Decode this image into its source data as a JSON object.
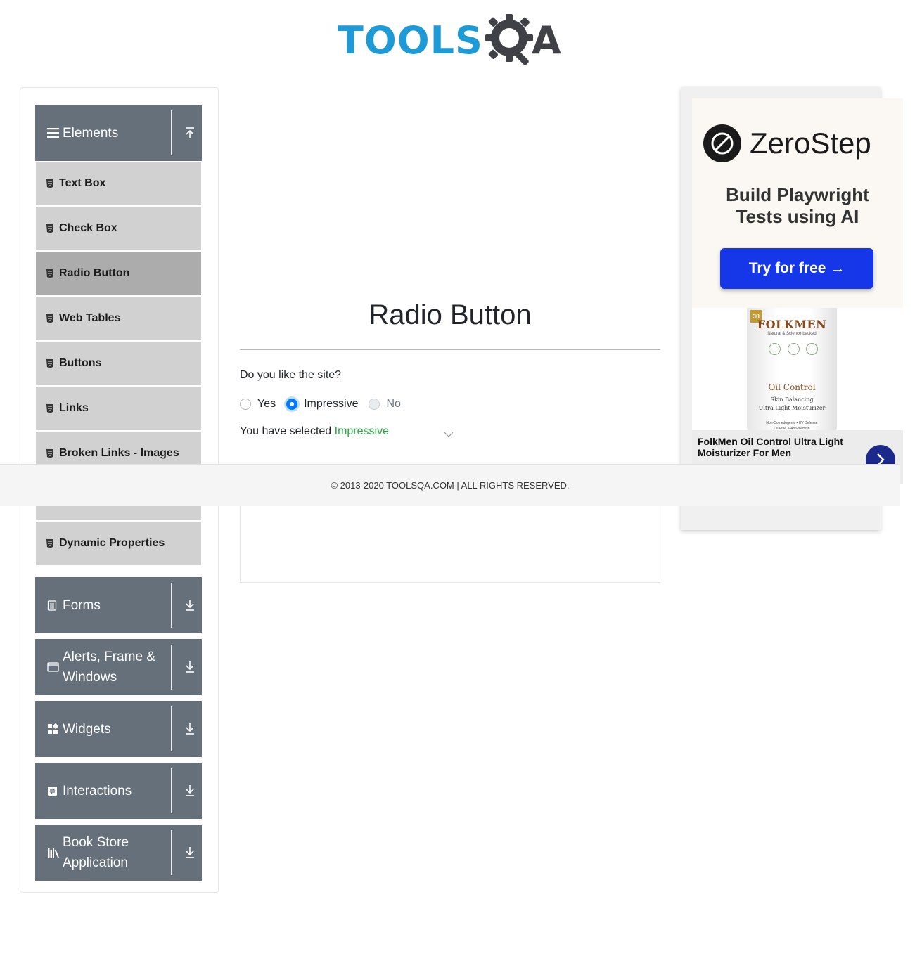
{
  "brand": {
    "logo_text_tools": "TOOLS",
    "logo_text_a": "A",
    "logo_color": "#1e9ad6"
  },
  "sidebar": {
    "groups": [
      {
        "label": "Elements",
        "icon": "hamburger-icon",
        "toggle_icon": "collapse-up-icon"
      },
      {
        "label": "Forms",
        "icon": "form-icon",
        "toggle_icon": "expand-down-icon"
      },
      {
        "label": "Alerts, Frame & Windows",
        "icon": "window-icon",
        "toggle_icon": "expand-down-icon"
      },
      {
        "label": "Widgets",
        "icon": "widgets-icon",
        "toggle_icon": "expand-down-icon"
      },
      {
        "label": "Interactions",
        "icon": "interactions-icon",
        "toggle_icon": "expand-down-icon"
      },
      {
        "label": "Book Store Application",
        "icon": "books-icon",
        "toggle_icon": "expand-down-icon"
      }
    ],
    "items": [
      {
        "label": "Text Box"
      },
      {
        "label": "Check Box"
      },
      {
        "label": "Radio Button",
        "active": true
      },
      {
        "label": "Web Tables"
      },
      {
        "label": "Buttons"
      },
      {
        "label": "Links"
      },
      {
        "label": "Broken Links - Images"
      },
      {
        "label": "Dynamic Properties"
      }
    ],
    "group_color": "#66707b",
    "item_color": "#d1d1d1",
    "active_item_color": "#acacac"
  },
  "main": {
    "title": "Radio Button",
    "question": "Do you like the site?",
    "options": [
      {
        "label": "Yes",
        "checked": false,
        "disabled": false
      },
      {
        "label": "Impressive",
        "checked": true,
        "disabled": false
      },
      {
        "label": "No",
        "checked": false,
        "disabled": true
      }
    ],
    "result_prefix": "You have selected ",
    "result_value": "Impressive",
    "result_color": "#28a745"
  },
  "ad": {
    "brand": "ZeroStep",
    "tagline_line1": "Build Playwright",
    "tagline_line2": "Tests using AI",
    "cta": "Try for free →",
    "product_brand": "FOLKMEN",
    "product_spf": "30",
    "product_sub": "Natural & Science-backed",
    "product_name": "Oil Control",
    "product_desc_line1": "Skin Balancing",
    "product_desc_line2": "Ultra Light Moisturizer",
    "product_foot_line1": "Non-Comedogenic • UV Defense",
    "product_foot_line2": "Oil Free & Anti-blemish",
    "caption": "FolkMen Oil Control Ultra Light Moisturizer For Men",
    "cta_color": "#1537e8"
  },
  "footer": {
    "text": "© 2013-2020 TOOLSQA.COM | ALL RIGHTS RESERVED."
  }
}
